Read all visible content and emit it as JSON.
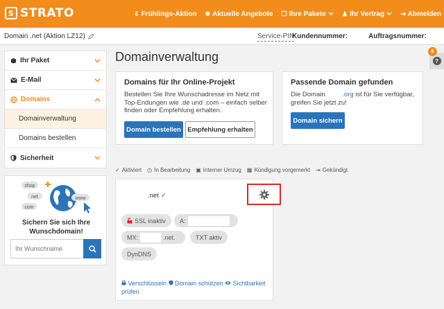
{
  "brand": {
    "logo_text": "STRATO",
    "logo_glyph": "S"
  },
  "topnav": [
    {
      "label": "Frühlings-Aktion",
      "icon": "gift-icon",
      "glyph": "⇩",
      "chevron": false
    },
    {
      "label": "Aktuelle Angebote",
      "icon": "tag-icon",
      "glyph": "✹",
      "chevron": false
    },
    {
      "label": "Ihre Pakete",
      "icon": "box-icon",
      "glyph": "❒",
      "chevron": true
    },
    {
      "label": "Ihr Vertrag",
      "icon": "user-icon",
      "glyph": "♟",
      "chevron": true
    },
    {
      "label": "Abmelden",
      "icon": "logout-icon",
      "glyph": "⇥",
      "chevron": false
    }
  ],
  "subbar": {
    "domain": "Domain .net (Aktion LZ12)",
    "service_pin": "Service-PIN",
    "customer_no_label": "Kundennummer:",
    "order_no_label": "Auftragsnummer:"
  },
  "sidebar": {
    "items": [
      {
        "label": "Ihr Paket",
        "icon": "box-icon"
      },
      {
        "label": "E-Mail",
        "icon": "mail-icon"
      },
      {
        "label": "Domains",
        "icon": "globe-icon"
      },
      {
        "label": "Sicherheit",
        "icon": "shield-icon"
      }
    ],
    "sub_items": [
      {
        "label": "Domainverwaltung"
      },
      {
        "label": "Domains bestellen"
      }
    ]
  },
  "promo": {
    "tags": [
      "shop",
      "net",
      "com",
      "www"
    ],
    "headline_1": "Sichern Sie sich Ihre",
    "headline_2": "Wunschdomain!",
    "search_placeholder": "Ihr Wunschname"
  },
  "page": {
    "title": "Domainverwaltung"
  },
  "card_project": {
    "title": "Domains für Ihr Online-Projekt",
    "text": "Bestellen Sie Ihre Wunschadresse im Netz mit Top-Endungen wie .de und .com – einfach selber finden oder Empfehlung erhalten.",
    "btn_order": "Domain bestellen",
    "btn_recommend": "Empfehlung erhalten"
  },
  "card_suggest": {
    "title": "Passende Domain gefunden",
    "text_prefix": "Die Domain",
    "domain_suffix": ".org",
    "text_suffix": "ist für Sie verfügbar,",
    "text_line2": "greifen Sie jetzt zu!",
    "btn_secure": "Domain sichern"
  },
  "help": {
    "badge_count": "6",
    "glyph": "?"
  },
  "legend": [
    {
      "label": "Aktiviert",
      "icon": "check-icon",
      "glyph": "✓"
    },
    {
      "label": "In Bearbeitung",
      "icon": "clock-icon",
      "glyph": "◷"
    },
    {
      "label": "Interner Umzug",
      "icon": "briefcase-icon",
      "glyph": "▣"
    },
    {
      "label": "Kündigung vorgemerkt",
      "icon": "calendar-icon",
      "glyph": "▦"
    },
    {
      "label": "Gekündigt",
      "icon": "signout-icon",
      "glyph": "⇥"
    }
  ],
  "domain_card": {
    "name": ".net",
    "status_glyph": "✓",
    "pills": {
      "ssl": "SSL inaktiv",
      "a_record": "A:",
      "mx": "MX:",
      "mx_suffix": ".net.",
      "txt": "TXT aktiv",
      "dyndns": "DynDNS"
    },
    "links": {
      "encrypt": "Verschlüsseln",
      "protect": "Domain schützen",
      "visibility_1": "Sichtbarkeit",
      "visibility_2": "prüfen"
    }
  },
  "colors": {
    "brand_orange": "#f28c1b",
    "primary_blue": "#2b74b9",
    "highlight_red": "#d9282f"
  }
}
